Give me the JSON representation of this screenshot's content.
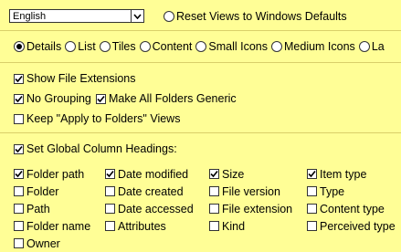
{
  "language_select": {
    "value": "English"
  },
  "reset_views": {
    "label": "Reset Views to Windows Defaults"
  },
  "view_modes": [
    {
      "label": "Details",
      "selected": true
    },
    {
      "label": "List",
      "selected": false
    },
    {
      "label": "Tiles",
      "selected": false
    },
    {
      "label": "Content",
      "selected": false
    },
    {
      "label": "Small Icons",
      "selected": false
    },
    {
      "label": "Medium Icons",
      "selected": false
    },
    {
      "label": "La",
      "selected": false
    }
  ],
  "options": {
    "show_file_extensions": {
      "label": "Show File Extensions",
      "checked": true
    },
    "no_grouping": {
      "label": "No Grouping",
      "checked": true
    },
    "make_all_folders_generic": {
      "label": "Make All Folders Generic",
      "checked": true
    },
    "keep_apply_to_folders": {
      "label": "Keep \"Apply to Folders\" Views",
      "checked": false
    },
    "set_global_column_headings": {
      "label": "Set Global Column Headings:",
      "checked": true
    }
  },
  "columns": {
    "col1": [
      {
        "label": "Folder path",
        "checked": true
      },
      {
        "label": "Folder",
        "checked": false
      },
      {
        "label": "Path",
        "checked": false
      },
      {
        "label": "Folder name",
        "checked": false
      },
      {
        "label": "Owner",
        "checked": false
      }
    ],
    "col2": [
      {
        "label": "Date modified",
        "checked": true
      },
      {
        "label": "Date created",
        "checked": false
      },
      {
        "label": "Date accessed",
        "checked": false
      },
      {
        "label": "Attributes",
        "checked": false
      }
    ],
    "col3": [
      {
        "label": "Size",
        "checked": true
      },
      {
        "label": "File version",
        "checked": false
      },
      {
        "label": "File extension",
        "checked": false
      },
      {
        "label": "Kind",
        "checked": false
      }
    ],
    "col4": [
      {
        "label": "Item type",
        "checked": true
      },
      {
        "label": "Type",
        "checked": false
      },
      {
        "label": "Content type",
        "checked": false
      },
      {
        "label": "Perceived type",
        "checked": false
      }
    ]
  }
}
